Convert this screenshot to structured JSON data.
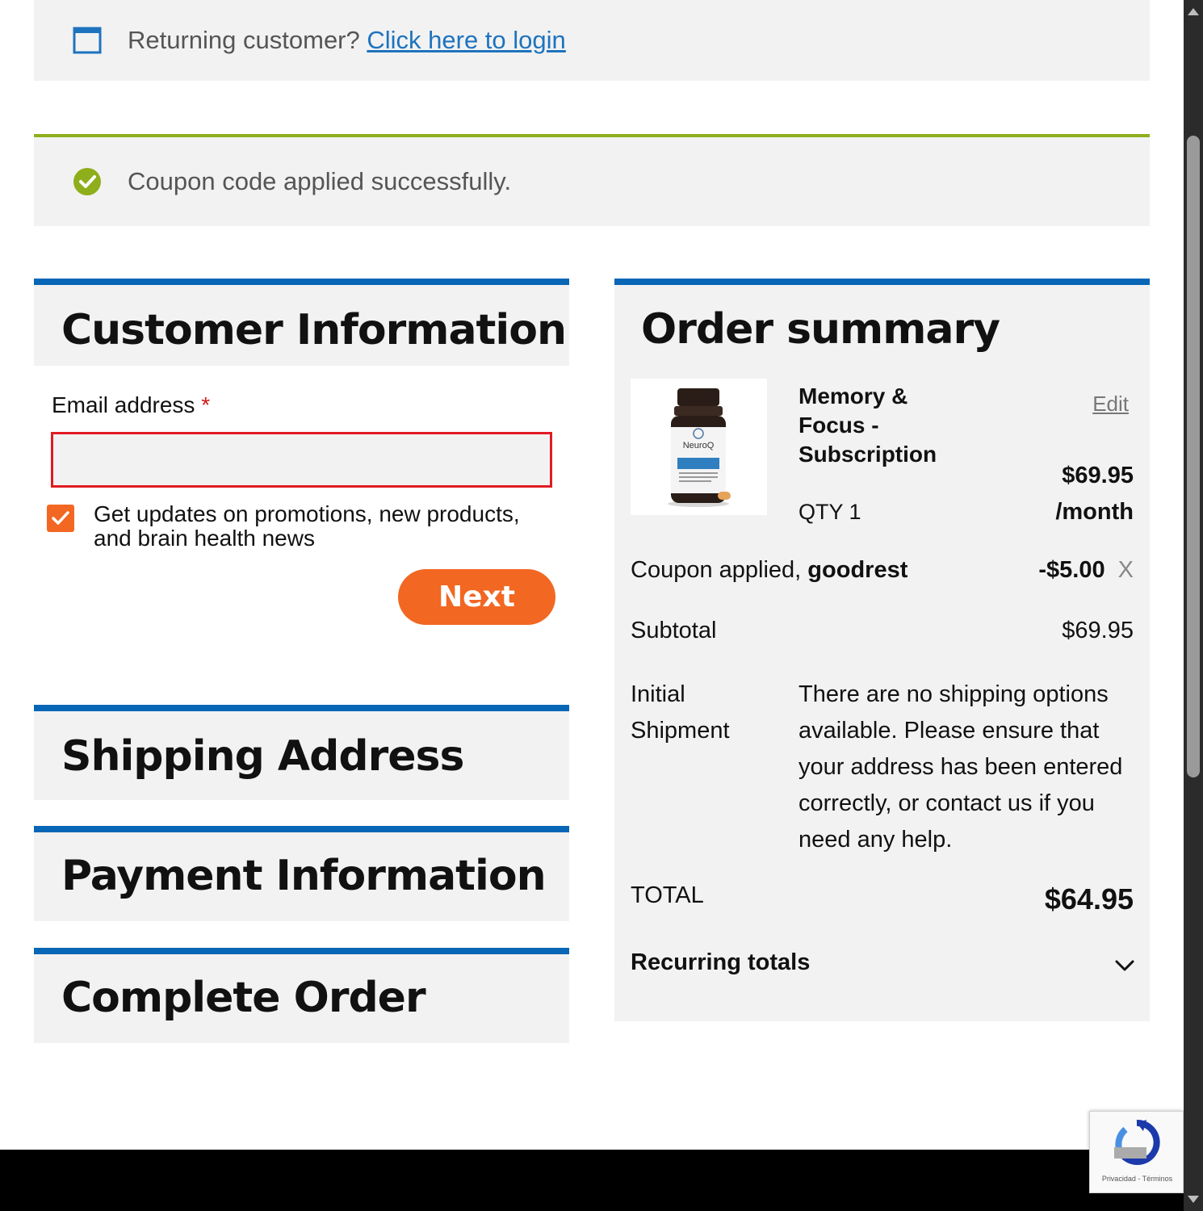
{
  "login_notice": {
    "prefix": "Returning customer?",
    "link": "Click here to login",
    "icon": "window-icon"
  },
  "coupon_notice": {
    "text": "Coupon code applied successfully.",
    "icon": "check-circle-icon"
  },
  "customer": {
    "title": "Customer Information",
    "email_label": "Email address",
    "required_mark": "*",
    "email_value": "",
    "optin_label": "Get updates on promotions, new products, and brain health news",
    "optin_checked": true,
    "next_label": "Next"
  },
  "sections": {
    "shipping": "Shipping Address",
    "payment": "Payment Information",
    "complete": "Complete Order"
  },
  "summary": {
    "title": "Order summary",
    "product": {
      "name": "Memory & Focus - Subscription",
      "edit": "Edit",
      "price": "$69.95",
      "period": "/month",
      "qty": "QTY 1",
      "image_text": "NeuroQ"
    },
    "coupon": {
      "label": "Coupon applied,",
      "code": "goodrest",
      "value": "-$5.00",
      "remove": "X"
    },
    "subtotal": {
      "label": "Subtotal",
      "value": "$69.95"
    },
    "shipment": {
      "label_line1": "Initial",
      "label_line2": "Shipment",
      "message": "There are no shipping options available. Please ensure that your address has been entered correctly, or contact us if you need any help."
    },
    "total": {
      "label": "TOTAL",
      "value": "$64.95"
    },
    "recurring": "Recurring totals"
  },
  "recaptcha": {
    "text": "Privacidad - Términos"
  },
  "colors": {
    "accent_blue": "#0866b6",
    "accent_orange": "#f26722",
    "success_green": "#8fae1b",
    "error_red": "#e11b22"
  }
}
